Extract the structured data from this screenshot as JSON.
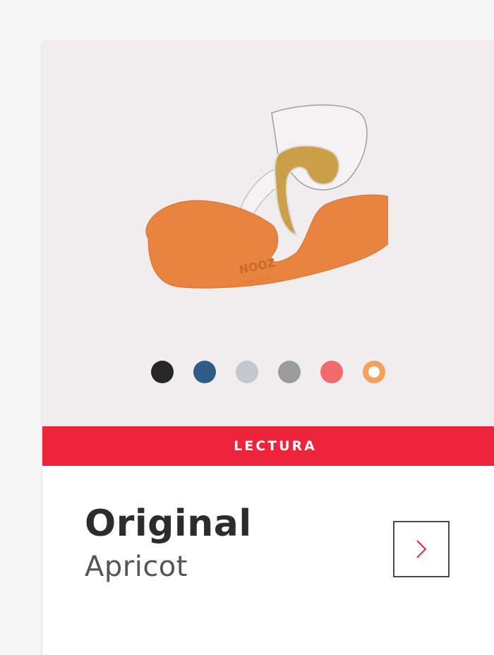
{
  "card": {
    "category_label": "LECTURA",
    "title": "Original",
    "subtitle": "Apricot",
    "image_logo_text": "NOOZ",
    "image_logo_subtext": "OPTICS"
  },
  "swatches": [
    {
      "name": "black",
      "color": "#262626",
      "selected": false
    },
    {
      "name": "blue",
      "color": "#2f5b87",
      "selected": false
    },
    {
      "name": "light-grey",
      "color": "#c2c8ce",
      "selected": false
    },
    {
      "name": "grey",
      "color": "#9a9c9c",
      "selected": false
    },
    {
      "name": "coral",
      "color": "#f26a6c",
      "selected": false
    },
    {
      "name": "apricot",
      "color": "#f5a05c",
      "selected": true
    }
  ],
  "colors": {
    "accent": "#ee233c",
    "product_case": "#e8843f",
    "background": "#f1ecee"
  },
  "icons": {
    "next": "chevron-right-icon"
  }
}
